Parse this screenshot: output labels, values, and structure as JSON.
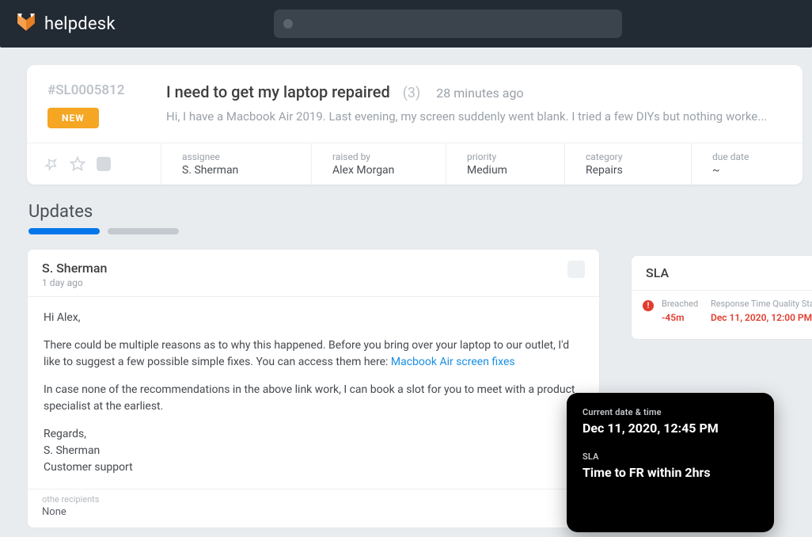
{
  "app": {
    "name": "helpdesk"
  },
  "search": {
    "placeholder": ""
  },
  "ticket": {
    "id": "#SL0005812",
    "status_badge": "NEW",
    "title": "I need to get my laptop repaired",
    "reply_count": "(3)",
    "age": "28 minutes ago",
    "preview": "Hi, I have a Macbook Air 2019. Last evening, my screen suddenly went blank. I tried a few DIYs but nothing worke...",
    "meta": {
      "assignee": {
        "label": "assignee",
        "value": "S. Sherman"
      },
      "raised_by": {
        "label": "raised by",
        "value": "Alex Morgan"
      },
      "priority": {
        "label": "priority",
        "value": "Medium"
      },
      "category": {
        "label": "category",
        "value": "Repairs"
      },
      "due_date": {
        "label": "due date",
        "value": "~"
      }
    }
  },
  "updates_section": {
    "title": "Updates"
  },
  "update": {
    "author": "S. Sherman",
    "time": "1 day ago",
    "greeting": "Hi Alex,",
    "para1_a": "There could be multiple reasons as to why this happened. Before you bring over your laptop to our outlet, I'd like to suggest a few possible simple fixes. You can access them here: ",
    "link_text": "Macbook Air screen fixes",
    "para2": "In case none of the recommendations in the above link work, I can book a slot for you to meet with a product specialist at the earliest.",
    "signoff1": "Regards,",
    "signoff2": "S. Sherman",
    "signoff3": "Customer support",
    "other_recipients_label": "othe recipients",
    "other_recipients_value": "None"
  },
  "sla": {
    "title": "SLA",
    "status": "Breached",
    "delta": "-45m",
    "standard_label": "Response Time Quality Stand",
    "standard_time": "Dec 11, 2020, 12:00 PM"
  },
  "overlay": {
    "dt_label": "Current date & time",
    "dt_value": "Dec 11, 2020, 12:45 PM",
    "sla_label": "SLA",
    "sla_value": "Time to FR within 2hrs"
  }
}
